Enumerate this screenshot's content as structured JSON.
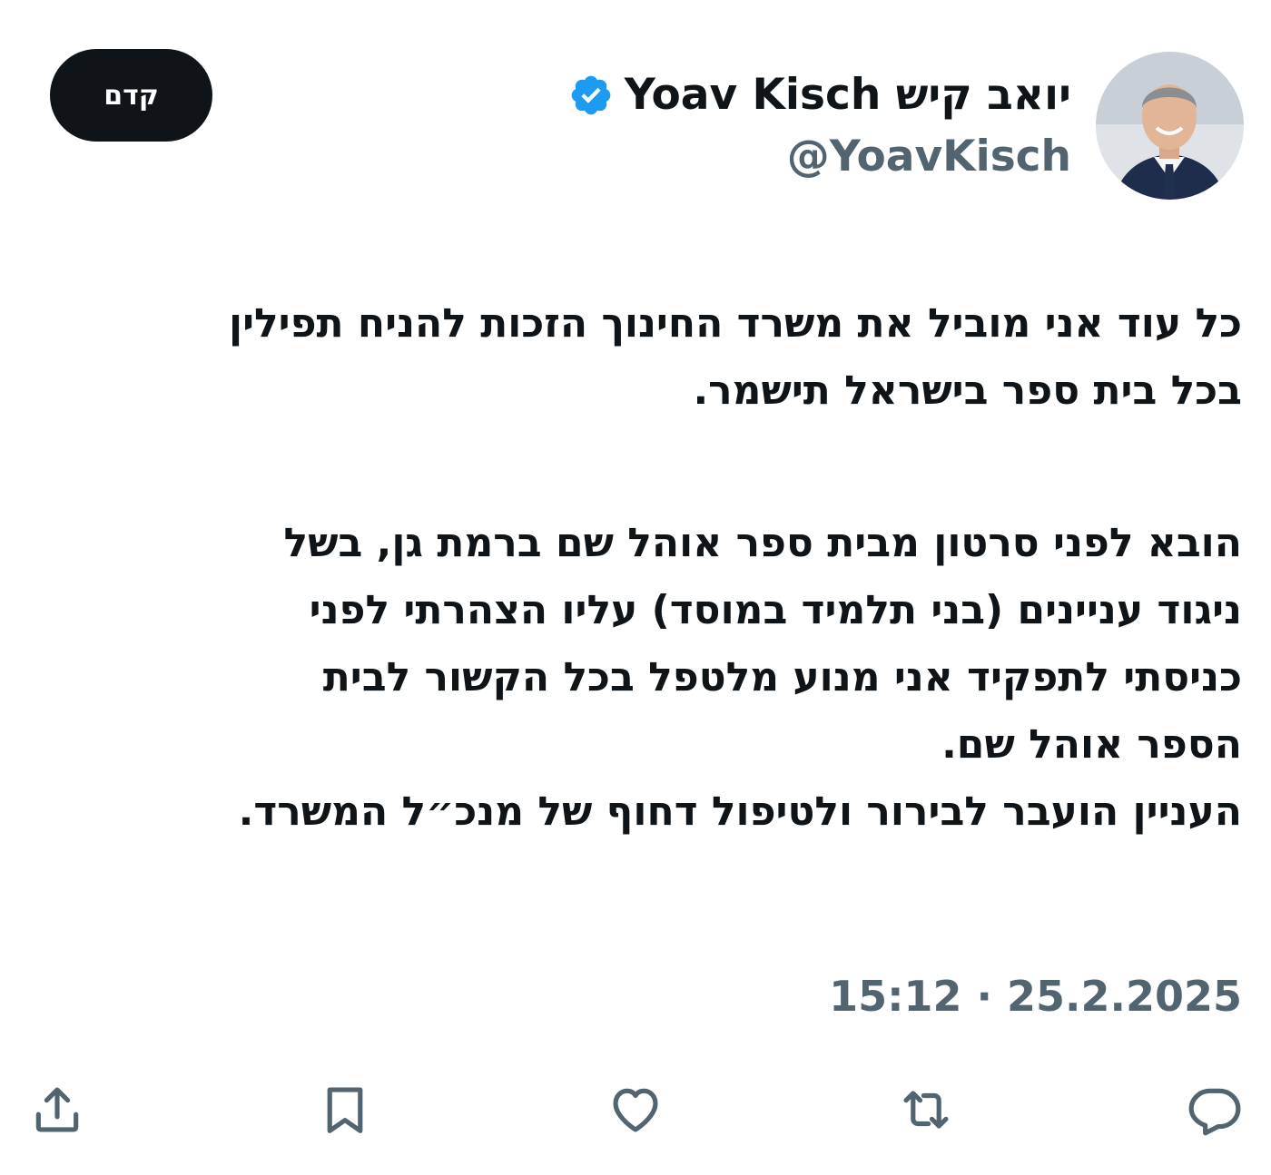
{
  "author": {
    "display_name": "Yoav Kisch יואב קיש",
    "handle": "@YoavKisch",
    "verified": true,
    "avatar_icon": "profile-photo",
    "verified_color": "#1d9bf0"
  },
  "follow_button": {
    "label": "קדם"
  },
  "tweet": {
    "lines": [
      "כל עוד אני מוביל את משרד החינוך הזכות להניח תפילין",
      "בכל בית ספר בישראל תישמר.",
      "",
      "הובא לפני סרטון מבית ספר אוהל שם ברמת גן, בשל",
      "ניגוד עניינים (בני תלמיד במוסד) עליו הצהרתי לפני",
      "כניסתי לתפקיד אני מנוע מלטפל בכל הקשור לבית",
      "הספר אוהל שם.",
      "העניין הועבר לבירור ולטיפול דחוף של מנכ״ל המשרד."
    ]
  },
  "timestamp": "15:12 · 25.2.2025",
  "actions": [
    {
      "name": "reply",
      "icon": "reply-icon"
    },
    {
      "name": "retweet",
      "icon": "retweet-icon"
    },
    {
      "name": "like",
      "icon": "heart-icon"
    },
    {
      "name": "bookmark",
      "icon": "bookmark-icon"
    },
    {
      "name": "share",
      "icon": "share-icon"
    }
  ],
  "colors": {
    "text_primary": "#0f1419",
    "text_secondary": "#536471",
    "button_bg": "#0f1419",
    "button_text": "#ffffff",
    "background": "#ffffff"
  }
}
